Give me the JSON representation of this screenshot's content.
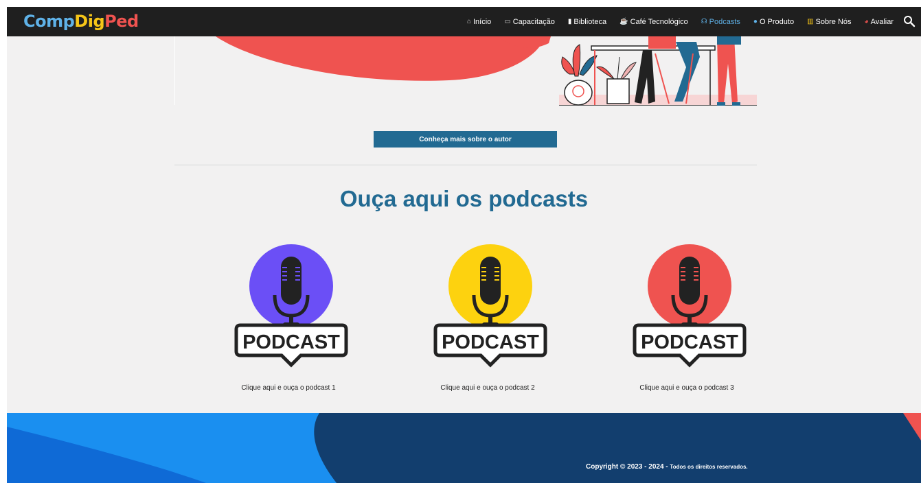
{
  "logo": {
    "parts": [
      {
        "text": "Comp",
        "color": "#5fb2e8"
      },
      {
        "text": "D",
        "color": "#f5c518"
      },
      {
        "text": "ig",
        "color": "#f5c518"
      },
      {
        "text": "P",
        "color": "#ef5350"
      },
      {
        "text": "ed",
        "color": "#ef5350"
      }
    ]
  },
  "nav": {
    "items": [
      {
        "icon": "⌂",
        "label": "Início",
        "active": false
      },
      {
        "icon": "▭",
        "label": "Capacitação",
        "active": false
      },
      {
        "icon": "▮",
        "label": "Biblioteca",
        "active": false
      },
      {
        "icon": "☕",
        "label": "Café Tecnológico",
        "active": false
      },
      {
        "icon": "☊",
        "label": "Podcasts",
        "active": true
      },
      {
        "icon": "●",
        "label": "O Produto",
        "active": false
      },
      {
        "icon": "▥",
        "label": "Sobre Nós",
        "active": false
      },
      {
        "icon": "◕",
        "label": "Avaliar",
        "active": false
      }
    ]
  },
  "author_button": "Conheça mais sobre o autor",
  "section_title": "Ouça aqui os podcasts",
  "podcasts": [
    {
      "badge": "PODCAST",
      "circle_color": "#6b4ff6",
      "caption": "Clique aqui e ouça o podcast 1"
    },
    {
      "badge": "PODCAST",
      "circle_color": "#fdd20f",
      "caption": "Clique aqui e ouça o podcast 2"
    },
    {
      "badge": "PODCAST",
      "circle_color": "#ef5350",
      "caption": "Clique aqui e ouça o podcast 3"
    }
  ],
  "footer": {
    "copyright_main": "Copyright © 2023 - 2024 - ",
    "copyright_small": "Todos os direitos reservados."
  },
  "colors": {
    "nav_bg": "#1f1f1f",
    "accent": "#226a92",
    "active_link": "#5fb2e8",
    "footer_dark": "#123e6e",
    "footer_light": "#1a8ff0"
  }
}
